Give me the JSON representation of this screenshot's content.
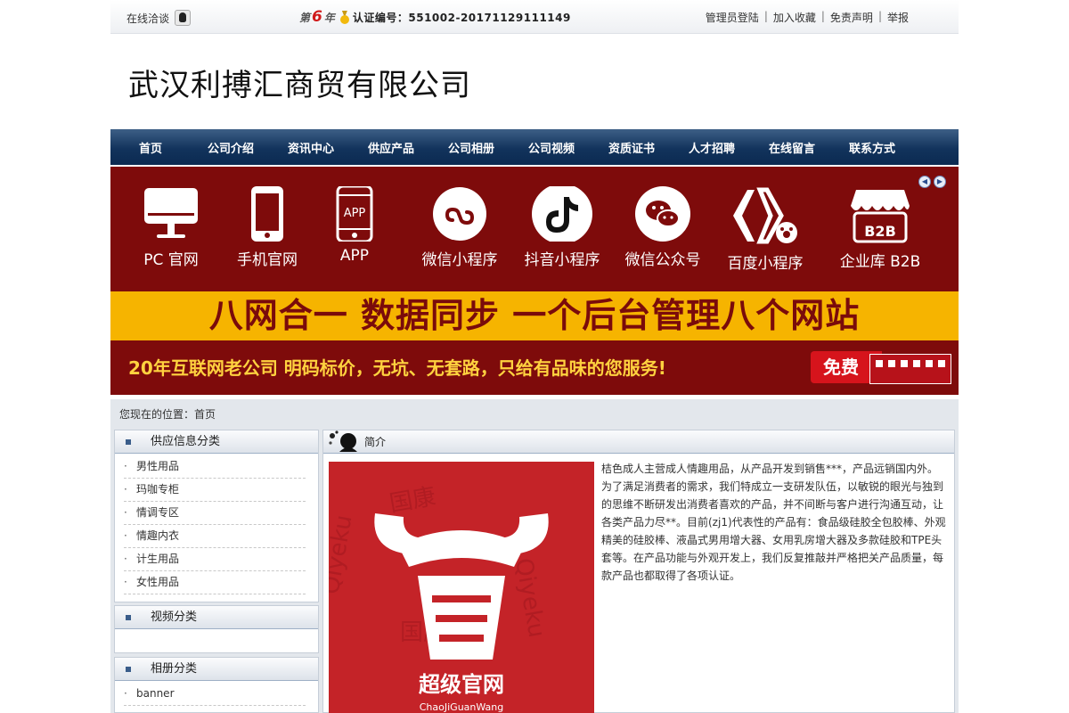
{
  "topbar": {
    "online_chat": "在线洽谈",
    "year_prefix": "第",
    "year_num": "6",
    "year_suffix": "年",
    "cert_label": "认证编号：551002-20171129111149",
    "links": [
      "管理员登陆",
      "加入收藏",
      "免责声明",
      "举报"
    ]
  },
  "company_name": "武汉利搏汇商贸有限公司",
  "nav": [
    "首页",
    "公司介绍",
    "资讯中心",
    "供应产品",
    "公司相册",
    "公司视频",
    "资质证书",
    "人才招聘",
    "在线留言",
    "联系方式"
  ],
  "banner": {
    "items": [
      {
        "label": "PC 官网",
        "icon": "monitor-icon"
      },
      {
        "label": "手机官网",
        "icon": "phone-icon"
      },
      {
        "label": "APP",
        "icon": "app-icon"
      },
      {
        "label": "微信小程序",
        "icon": "mini-program-icon"
      },
      {
        "label": "抖音小程序",
        "icon": "tiktok-icon"
      },
      {
        "label": "微信公众号",
        "icon": "wechat-icon"
      },
      {
        "label": "百度小程序",
        "icon": "baidu-icon"
      },
      {
        "label": "企业库 B2B",
        "icon": "store-icon"
      }
    ],
    "app_text": "APP",
    "b2b_text": "B2B",
    "headline": "八网合一  数据同步  一个后台管理八个网站",
    "slogan": "20年互联网老公司  明码标价，无坑、无套路，只给有品味的您服务!",
    "button": "免费"
  },
  "location": "您现在的位置：首页",
  "sidebar": {
    "supply": {
      "title": "供应信息分类",
      "items": [
        "男性用品",
        "玛咖专柜",
        "情调专区",
        "情趣内衣",
        "计生用品",
        "女性用品"
      ]
    },
    "video": {
      "title": "视频分类"
    },
    "album": {
      "title": "相册分类",
      "items": [
        "banner"
      ]
    }
  },
  "content": {
    "title": "简介",
    "image_caption": "超级官网",
    "image_caption_pinyin": "ChaoJiGuanWang",
    "text": "桔色成人主营成人情趣用品，从产品开发到销售***，产品远销国内外。为了满足消费者的需求，我们特成立一支研发队伍，以敏锐的眼光与独到的思维不断研发出消费者喜欢的产品，并不间断与客户进行沟通互动，让各类产品力尽**。目前(zj1)代表性的产品有：食品级硅胶全包胶棒、外观精美的硅胶棒、液晶式男用增大器、女用乳房增大器及多款硅胶和TPE头套等。在产品功能与外观开发上，我们反复推敲并严格把关产品质量，每款产品也都取得了各项认证。"
  },
  "colors": {
    "nav_dark": "#0b2a51",
    "banner_red": "#7e0b0b",
    "banner_yellow": "#f6b400",
    "headline_text": "#7a0b0b",
    "slogan_text": "#ffd23f"
  }
}
